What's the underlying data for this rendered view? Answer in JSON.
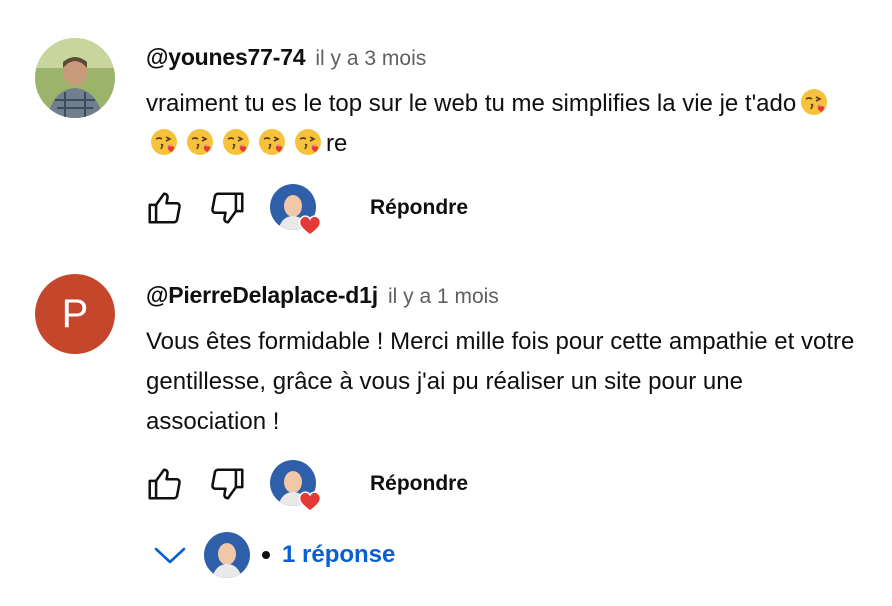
{
  "comments": [
    {
      "author": "@younes77-74",
      "time": "il y a 3 mois",
      "text_before": "vraiment tu es le top sur le web tu me simplifies la vie je t'ado",
      "emoji_count": 6,
      "text_after": "re",
      "reply_label": "Répondre"
    },
    {
      "author": "@PierreDelaplace-d1j",
      "time": "il y a 1 mois",
      "avatar_letter": "P",
      "text": "Vous êtes formidable ! Merci mille fois pour cette ampathie et votre gentillesse, grâce à vous j'ai pu réaliser un site pour une association !",
      "reply_label": "Répondre",
      "replies_label": "1 réponse"
    }
  ],
  "colors": {
    "avatar_p": "#c4472c",
    "link_blue": "#065fd4",
    "heart_red": "#e53935"
  },
  "icons": [
    "thumbs-up-icon",
    "thumbs-down-icon",
    "creator-heart-icon",
    "chevron-down-icon",
    "kissing-face-emoji"
  ]
}
